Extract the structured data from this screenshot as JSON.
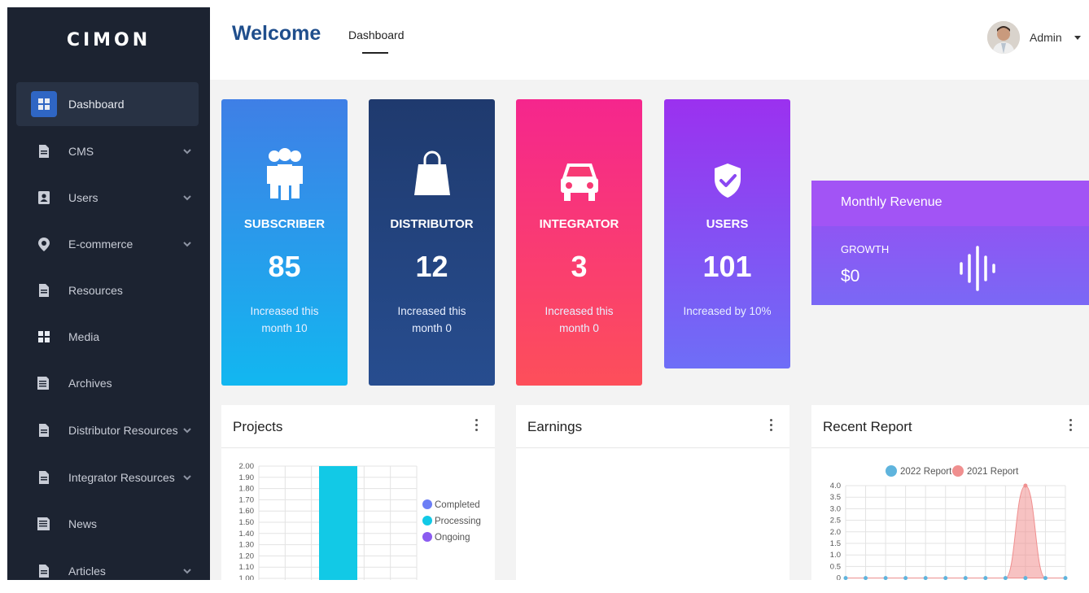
{
  "app": {
    "logo": "CIMON"
  },
  "sidebar": {
    "items": [
      {
        "label": "Dashboard",
        "icon": "grid-icon",
        "active": true,
        "chevron": false
      },
      {
        "label": "CMS",
        "icon": "document-icon",
        "active": false,
        "chevron": true
      },
      {
        "label": "Users",
        "icon": "user-card-icon",
        "active": false,
        "chevron": true
      },
      {
        "label": "E-commerce",
        "icon": "location-icon",
        "active": false,
        "chevron": true
      },
      {
        "label": "Resources",
        "icon": "document-icon",
        "active": false,
        "chevron": false
      },
      {
        "label": "Media",
        "icon": "grid-icon",
        "active": false,
        "chevron": false
      },
      {
        "label": "Archives",
        "icon": "archive-icon",
        "active": false,
        "chevron": false
      },
      {
        "label": "Distributor Resources",
        "icon": "document-icon",
        "active": false,
        "chevron": true
      },
      {
        "label": "Integrator Resources",
        "icon": "document-icon",
        "active": false,
        "chevron": true
      },
      {
        "label": "News",
        "icon": "news-icon",
        "active": false,
        "chevron": false
      },
      {
        "label": "Articles",
        "icon": "document-icon",
        "active": false,
        "chevron": true
      }
    ]
  },
  "header": {
    "welcome": "Welcome",
    "tab": "Dashboard",
    "user": "Admin"
  },
  "stats": [
    {
      "title": "SUBSCRIBER",
      "value": "85",
      "note": "Increased this month 10",
      "icon": "people-icon",
      "colors": [
        "#3f7fe6",
        "#12b7f0"
      ]
    },
    {
      "title": "DISTRIBUTOR",
      "value": "12",
      "note": "Increased this month 0",
      "icon": "shopping-bag-icon",
      "colors": [
        "#1f3a6e",
        "#274d8f"
      ]
    },
    {
      "title": "INTEGRATOR",
      "value": "3",
      "note": "Increased this month 0",
      "icon": "car-icon",
      "colors": [
        "#f5268d",
        "#fd4f5a"
      ]
    },
    {
      "title": "USERS",
      "value": "101",
      "note": "Increased by 10%",
      "icon": "shield-check-icon",
      "colors": [
        "#9b31ef",
        "#6e6ef7"
      ]
    }
  ],
  "revenue": {
    "title": "Monthly Revenue",
    "growth_label": "GROWTH",
    "growth_value": "$0",
    "icon": "soundwave-icon"
  },
  "panels": {
    "projects": {
      "title": "Projects"
    },
    "earnings": {
      "title": "Earnings"
    },
    "report": {
      "title": "Recent Report"
    }
  },
  "chart_data": [
    {
      "type": "bar",
      "categories": [
        ""
      ],
      "series": [
        {
          "name": "Completed",
          "values": [
            0
          ],
          "color": "#6c7ef5"
        },
        {
          "name": "Processing",
          "values": [
            2.0
          ],
          "color": "#12c9e6"
        },
        {
          "name": "Ongoing",
          "values": [
            0
          ],
          "color": "#8b5cf0"
        }
      ],
      "yticks": [
        "2.00",
        "1.90",
        "1.80",
        "1.70",
        "1.60",
        "1.50",
        "1.40",
        "1.30",
        "1.20",
        "1.10",
        "1.00"
      ],
      "ylim": [
        1.0,
        2.0
      ],
      "grid": true,
      "legend": "right"
    },
    {
      "type": "area",
      "series": [
        {
          "name": "2022 Report",
          "values": [
            0,
            0,
            0,
            0,
            0,
            0,
            0,
            0,
            0,
            0,
            0,
            0
          ],
          "color": "#5fb4dd"
        },
        {
          "name": "2021 Report",
          "values": [
            0,
            0,
            0,
            0,
            0,
            0,
            0,
            0,
            0,
            4,
            0,
            0
          ],
          "color": "#f08f8f"
        }
      ],
      "yticks": [
        "4.0",
        "3.5",
        "3.0",
        "2.5",
        "2.0",
        "1.5",
        "1.0",
        "0.5",
        "0"
      ],
      "ylim": [
        0,
        4
      ],
      "grid": true,
      "legend": "top"
    }
  ]
}
